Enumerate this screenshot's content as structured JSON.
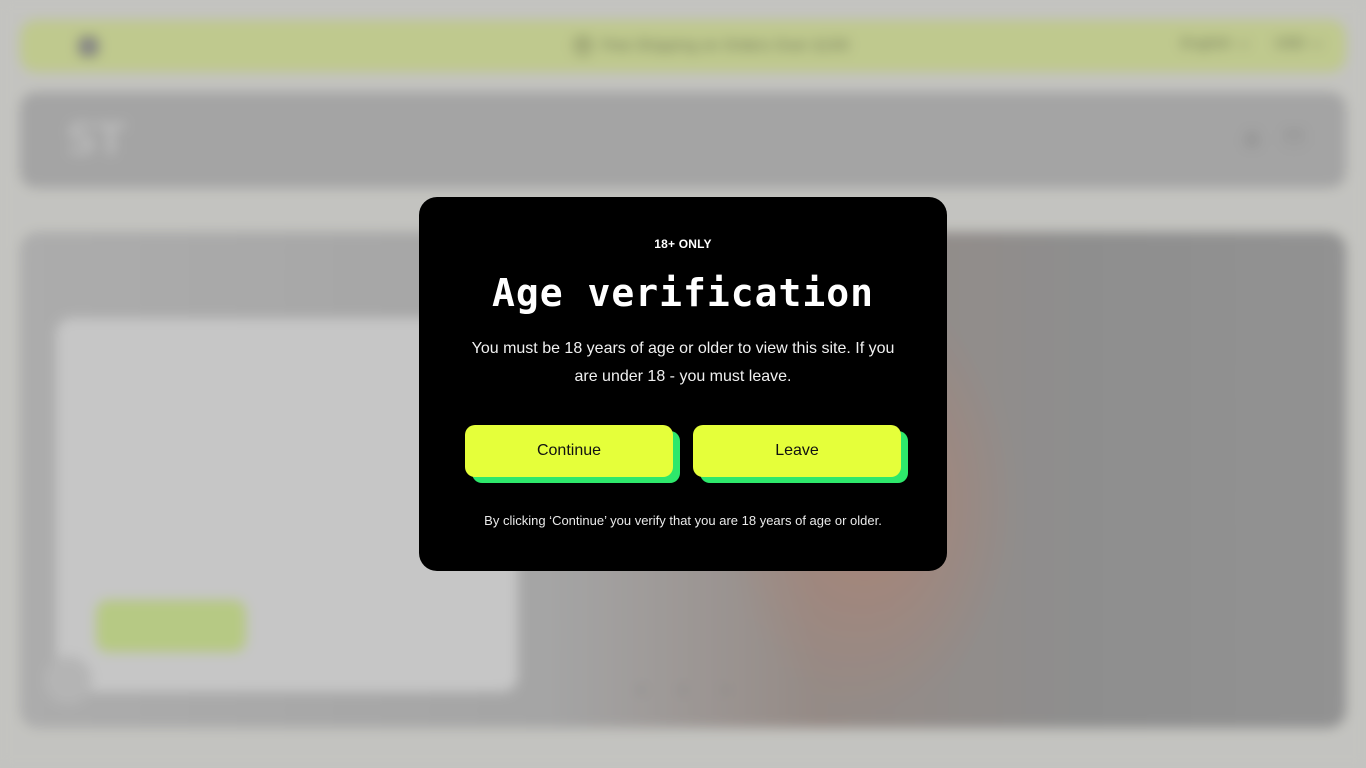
{
  "announcement": {
    "shipping_text": "Free Shipping on Orders Over $100",
    "language": "English",
    "currency": "USD",
    "icons": [
      "instagram-icon",
      "package-icon",
      "chevron-down-icon"
    ]
  },
  "header": {
    "logo_text": "ST",
    "icons": [
      "account-icon",
      "cart-icon"
    ]
  },
  "modal": {
    "eyebrow": "18+ ONLY",
    "title": "Age verification",
    "description": "You must be 18 years of age or older to view this site. If you are under 18 - you must leave.",
    "continue_label": "Continue",
    "leave_label": "Leave",
    "footnote": "By clicking ‘Continue’ you verify that you are 18 years of age or older."
  },
  "colors": {
    "announcement_bg": "#e5f49a",
    "button_bg": "#e5ff3a",
    "button_shadow": "#2ee86b",
    "modal_bg": "#000000"
  }
}
